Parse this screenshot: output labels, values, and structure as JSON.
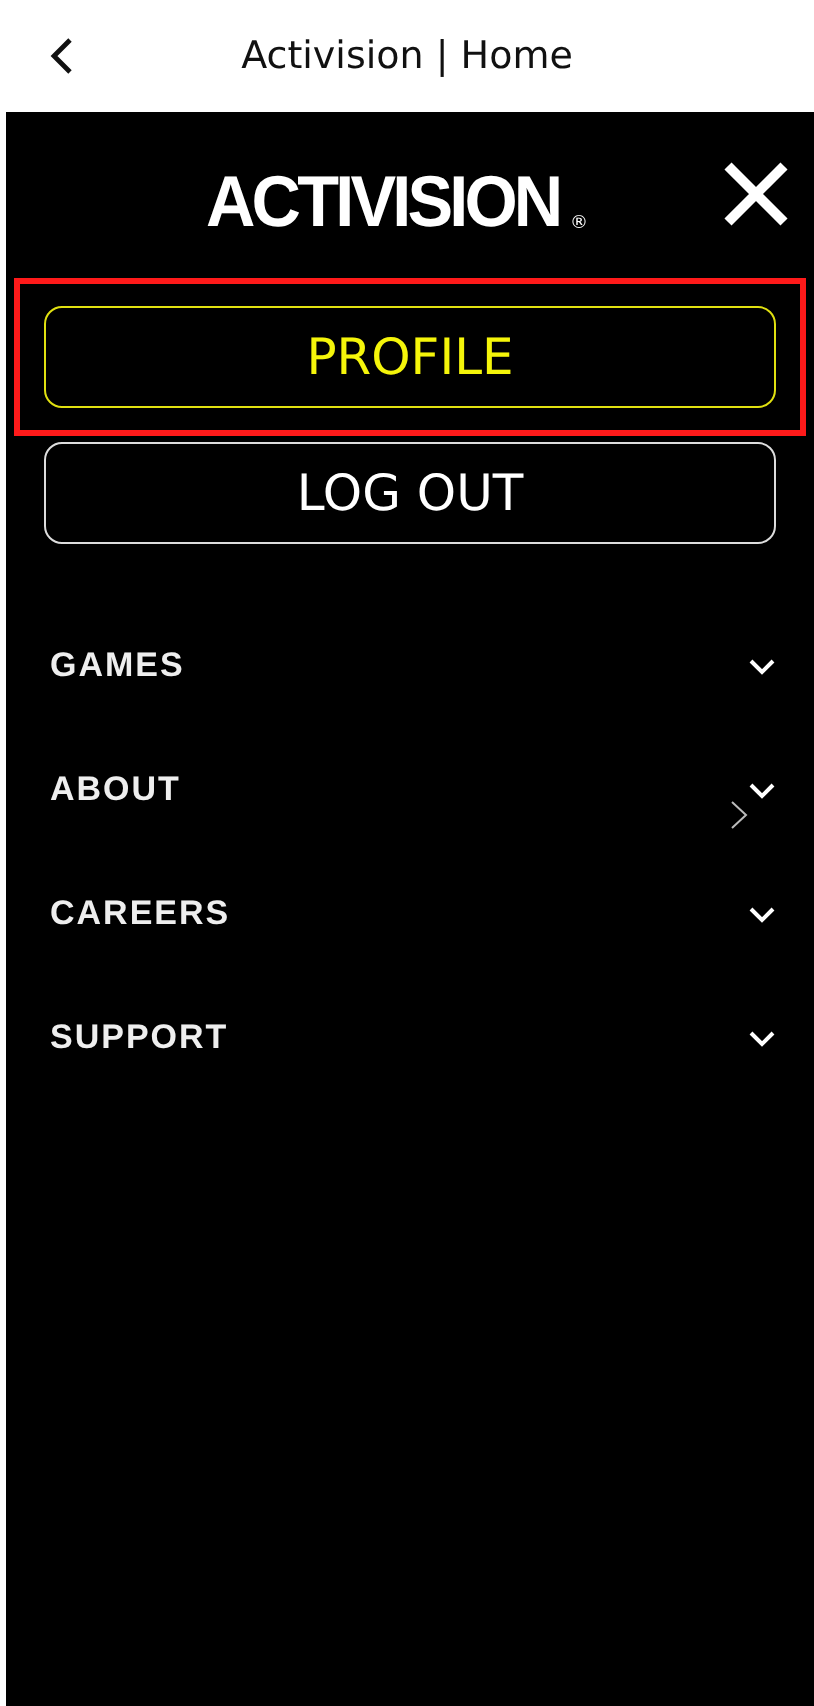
{
  "top_bar": {
    "title": "Activision | Home"
  },
  "menu": {
    "logo": {
      "wordmark": "ACTIVISION",
      "registered": "®"
    },
    "buttons": [
      {
        "label": "PROFILE",
        "kind": "accent",
        "highlighted": true
      },
      {
        "label": "LOG OUT",
        "kind": "plain",
        "highlighted": false
      }
    ],
    "items": [
      {
        "label": "GAMES",
        "expanded": false
      },
      {
        "label": "ABOUT",
        "expanded": false
      },
      {
        "label": "CAREERS",
        "expanded": false
      },
      {
        "label": "SUPPORT",
        "expanded": false
      }
    ]
  }
}
